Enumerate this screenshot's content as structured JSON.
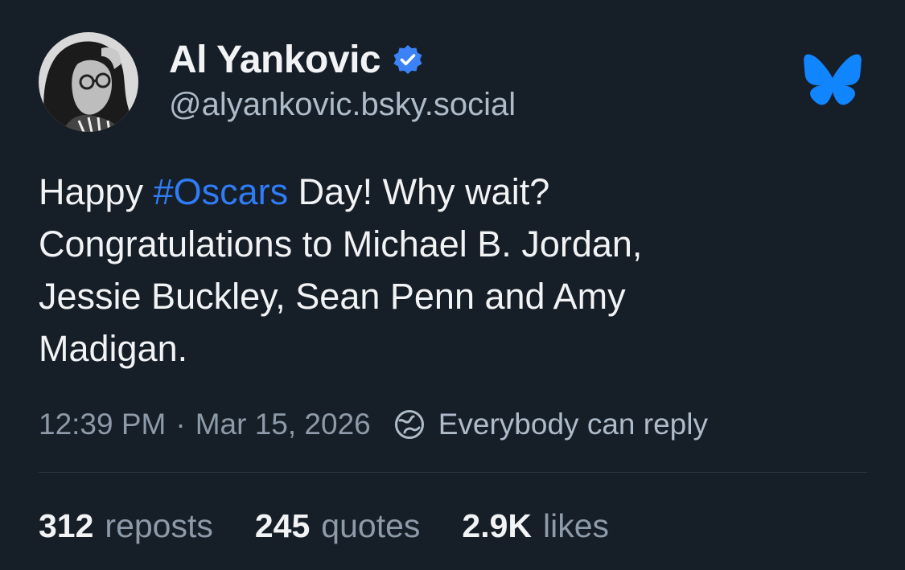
{
  "author": {
    "display_name": "Al Yankovic",
    "handle": "@alyankovic.bsky.social",
    "verified": true,
    "avatar_icon": "avatar-photo"
  },
  "brand": {
    "logo_icon": "bluesky-butterfly-icon",
    "color": "#1185fe"
  },
  "post": {
    "lines": [
      {
        "before": "Happy ",
        "hashtag": "#Oscars",
        "after": " Day! Why wait?"
      },
      {
        "text": "Congratulations to Michael B. Jordan,"
      },
      {
        "text": "Jessie Buckley, Sean Penn and Amy"
      },
      {
        "text": "Madigan."
      }
    ],
    "time": "12:39 PM",
    "separator": "·",
    "date": "Mar 15, 2026",
    "reply_setting": "Everybody can reply",
    "reply_icon": "reply-settings-icon"
  },
  "stats": {
    "reposts": {
      "count": "312",
      "label": "reposts"
    },
    "quotes": {
      "count": "245",
      "label": "quotes"
    },
    "likes": {
      "count": "2.9K",
      "label": "likes"
    }
  },
  "colors": {
    "background": "#161e27",
    "text": "#f1f3f5",
    "secondary_text": "#8d9aa8",
    "hashtag": "#2f7cf6",
    "verified_badge": "#3b82f6"
  }
}
